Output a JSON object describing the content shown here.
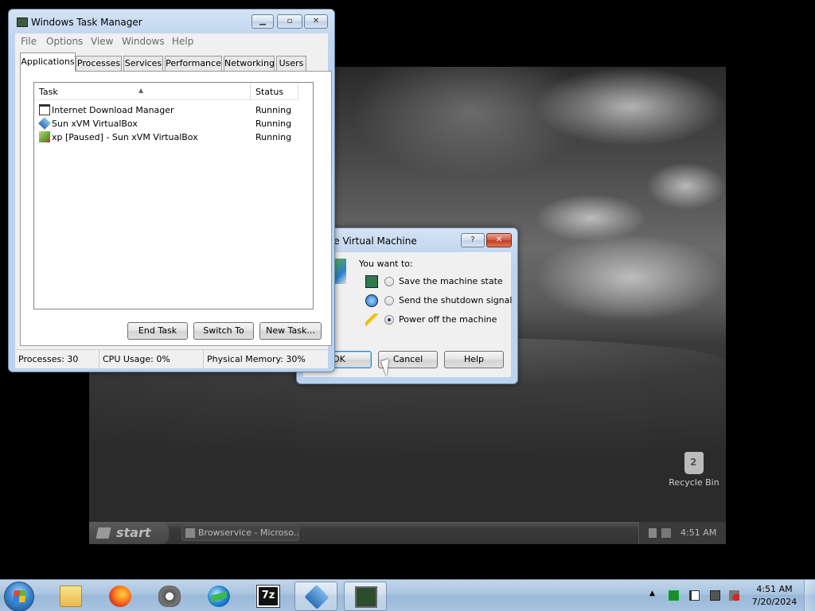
{
  "vm": {
    "recycle_bin": "Recycle Bin",
    "start_label": "start",
    "task_label": "Browservice - Microso...",
    "clock": "4:51 AM"
  },
  "task_manager": {
    "title": "Windows Task Manager",
    "menu": [
      "File",
      "Options",
      "View",
      "Windows",
      "Help"
    ],
    "tabs": [
      "Applications",
      "Processes",
      "Services",
      "Performance",
      "Networking",
      "Users"
    ],
    "active_tab": "Applications",
    "columns": [
      "Task",
      "Status"
    ],
    "rows": [
      {
        "task": "Internet Download Manager",
        "status": "Running",
        "icon": "window-icon"
      },
      {
        "task": "Sun xVM VirtualBox",
        "status": "Running",
        "icon": "virtualbox-icon"
      },
      {
        "task": "xp [Paused] - Sun xVM VirtualBox",
        "status": "Running",
        "icon": "vm-paused-icon"
      }
    ],
    "buttons": {
      "end_task": "End Task",
      "switch_to": "Switch To",
      "new_task": "New Task..."
    },
    "status": {
      "processes": "Processes: 30",
      "cpu": "CPU Usage: 0%",
      "memory": "Physical Memory: 30%"
    }
  },
  "close_vm": {
    "title": "se Virtual Machine",
    "prompt": "You want to:",
    "options": [
      {
        "label": "Save the machine state",
        "selected": false,
        "icon": "save-state-icon"
      },
      {
        "label": "Send the shutdown signal",
        "selected": false,
        "icon": "power-button-icon"
      },
      {
        "label": "Power off the machine",
        "selected": true,
        "icon": "lightning-icon"
      }
    ],
    "buttons": {
      "ok": "OK",
      "cancel": "Cancel",
      "help": "Help"
    },
    "help_glyph": "?",
    "close_glyph": "✕"
  },
  "taskbar": {
    "pinned": [
      "windows-explorer",
      "firefox",
      "idm",
      "download-manager",
      "7-zip",
      "virtualbox",
      "task-manager"
    ],
    "seven_zip_label": "7z",
    "clock_time": "4:51 AM",
    "clock_date": "7/20/2024"
  }
}
